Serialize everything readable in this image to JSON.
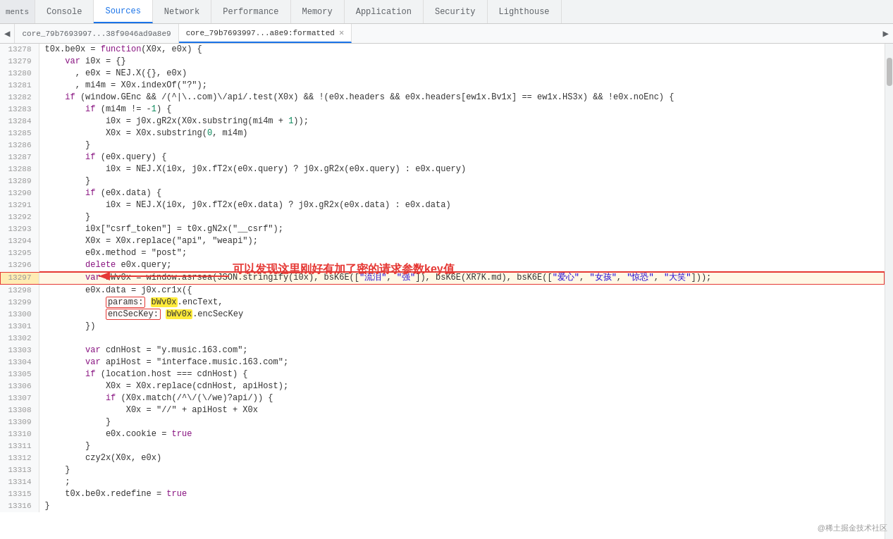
{
  "tabs": {
    "items": [
      {
        "label": "ments",
        "active": false
      },
      {
        "label": "Console",
        "active": false
      },
      {
        "label": "Sources",
        "active": true
      },
      {
        "label": "Network",
        "active": false
      },
      {
        "label": "Performance",
        "active": false
      },
      {
        "label": "Memory",
        "active": false
      },
      {
        "label": "Application",
        "active": false
      },
      {
        "label": "Security",
        "active": false
      },
      {
        "label": "Lighthouse",
        "active": false
      }
    ]
  },
  "file_tabs": {
    "prev_label": "◀",
    "next_label": "▶",
    "items": [
      {
        "label": "core_79b7693997...38f9046ad9a8e9",
        "active": false,
        "closable": false
      },
      {
        "label": "core_79b7693997...a8e9:formatted",
        "active": true,
        "closable": true
      }
    ]
  },
  "code": {
    "lines": [
      {
        "num": "13278",
        "code": "t0x.be0x = function(X0x, e0x) {",
        "highlight": false
      },
      {
        "num": "13279",
        "code": "    var i0x = {}",
        "highlight": false
      },
      {
        "num": "13280",
        "code": "      , e0x = NEJ.X({}, e0x)",
        "highlight": false
      },
      {
        "num": "13281",
        "code": "      , mi4m = X0x.indexOf(\"?\");",
        "highlight": false
      },
      {
        "num": "13282",
        "code": "    if (window.GEnc && /(^|\\..com)\\/api/.test(X0x) && !(e0x.headers && e0x.headers[ew1x.Bv1x] == ew1x.HS3x) && !e0x.noEnc) {",
        "highlight": false
      },
      {
        "num": "13283",
        "code": "        if (mi4m != -1) {",
        "highlight": false
      },
      {
        "num": "13284",
        "code": "            i0x = j0x.gR2x(X0x.substring(mi4m + 1));",
        "highlight": false
      },
      {
        "num": "13285",
        "code": "            X0x = X0x.substring(0, mi4m)",
        "highlight": false
      },
      {
        "num": "13286",
        "code": "        }",
        "highlight": false
      },
      {
        "num": "13287",
        "code": "        if (e0x.query) {",
        "highlight": false
      },
      {
        "num": "13288",
        "code": "            i0x = NEJ.X(i0x, j0x.fT2x(e0x.query) ? j0x.gR2x(e0x.query) : e0x.query)",
        "highlight": false
      },
      {
        "num": "13289",
        "code": "        }",
        "highlight": false
      },
      {
        "num": "13290",
        "code": "        if (e0x.data) {",
        "highlight": false
      },
      {
        "num": "13291",
        "code": "            i0x = NEJ.X(i0x, j0x.fT2x(e0x.data) ? j0x.gR2x(e0x.data) : e0x.data)",
        "highlight": false
      },
      {
        "num": "13292",
        "code": "        }",
        "highlight": false
      },
      {
        "num": "13293",
        "code": "        i0x[\"csrf_token\"] = t0x.gN2x(\"__csrf\");",
        "highlight": false
      },
      {
        "num": "13294",
        "code": "        X0x = X0x.replace(\"api\", \"weapi\");",
        "highlight": false
      },
      {
        "num": "13295",
        "code": "        e0x.method = \"post\";",
        "highlight": false
      },
      {
        "num": "13296",
        "code": "        delete e0x.query;",
        "highlight": false
      },
      {
        "num": "13297",
        "code": "        var bWv0x = window.asrsea(JSON.stringify(i0x), bsK6E([\"流泪\", \"强\"]), bsK6E(XR7K.md), bsK6E([\"爱心\", \"女孩\", \"惊恐\", \"大笑\"]));",
        "highlight": true,
        "bordered": true
      },
      {
        "num": "13298",
        "code": "        e0x.data = j0x.cr1x({",
        "highlight": false
      },
      {
        "num": "13299",
        "code": "            params: bWv0x.encText,",
        "highlight": false,
        "params_hl": true
      },
      {
        "num": "13300",
        "code": "            encSecKey: bWv0x.encSecKey",
        "highlight": false,
        "enc_hl": true
      },
      {
        "num": "13301",
        "code": "        })",
        "highlight": false
      },
      {
        "num": "13302",
        "code": "",
        "highlight": false
      },
      {
        "num": "13303",
        "code": "        var cdnHost = \"y.music.163.com\";",
        "highlight": false
      },
      {
        "num": "13304",
        "code": "        var apiHost = \"interface.music.163.com\";",
        "highlight": false
      },
      {
        "num": "13305",
        "code": "        if (location.host === cdnHost) {",
        "highlight": false
      },
      {
        "num": "13306",
        "code": "            X0x = X0x.replace(cdnHost, apiHost);",
        "highlight": false
      },
      {
        "num": "13307",
        "code": "            if (X0x.match(/^\\/(\\/we)?api/)) {",
        "highlight": false
      },
      {
        "num": "13308",
        "code": "                X0x = \"//\" + apiHost + X0x",
        "highlight": false
      },
      {
        "num": "13309",
        "code": "            }",
        "highlight": false
      },
      {
        "num": "13310",
        "code": "            e0x.cookie = true",
        "highlight": false
      },
      {
        "num": "13311",
        "code": "        }",
        "highlight": false
      },
      {
        "num": "13312",
        "code": "        czy2x(X0x, e0x)",
        "highlight": false
      },
      {
        "num": "13313",
        "code": "    }",
        "highlight": false
      },
      {
        "num": "13314",
        "code": "    ;",
        "highlight": false
      },
      {
        "num": "13315",
        "code": "    t0x.be0x.redefine = true",
        "highlight": false
      },
      {
        "num": "13316",
        "code": "}",
        "highlight": false
      }
    ]
  },
  "annotation": {
    "text": "可以发现这里刚好有加了密的请求参数key值",
    "arrow_label": "→"
  },
  "watermark": "@稀土掘金技术社区"
}
